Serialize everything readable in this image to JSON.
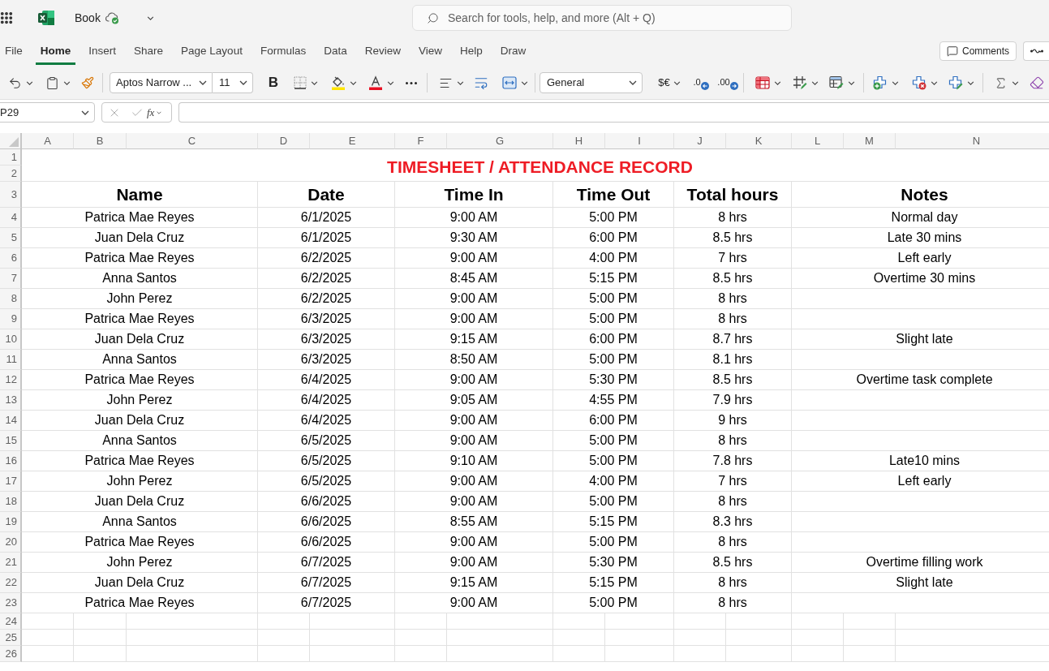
{
  "app_bar": {
    "document_title": "Book",
    "search": {
      "placeholder": "Search for tools, help, and more (Alt + Q)"
    }
  },
  "ribbon_tabs": [
    {
      "label": "File",
      "selected": false
    },
    {
      "label": "Home",
      "selected": true
    },
    {
      "label": "Insert",
      "selected": false
    },
    {
      "label": "Share",
      "selected": false
    },
    {
      "label": "Page Layout",
      "selected": false
    },
    {
      "label": "Formulas",
      "selected": false
    },
    {
      "label": "Data",
      "selected": false
    },
    {
      "label": "Review",
      "selected": false
    },
    {
      "label": "View",
      "selected": false
    },
    {
      "label": "Help",
      "selected": false
    },
    {
      "label": "Draw",
      "selected": false
    }
  ],
  "header_buttons": [
    {
      "label": "Comments"
    }
  ],
  "toolbar": {
    "font_name": "Aptos Narrow ...",
    "font_size": "11",
    "bold_label": "B",
    "number_format": "General",
    "currency_label": "$€",
    "decrease_decimal_label": ".0",
    "increase_decimal_label": ".00"
  },
  "formula_bar": {
    "name_box": "P29",
    "function_label": "fx"
  },
  "sheet": {
    "column_letters": [
      "A",
      "B",
      "C",
      "D",
      "E",
      "F",
      "G",
      "H",
      "I",
      "J",
      "K",
      "L",
      "M",
      "N"
    ],
    "row_numbers": [
      "1",
      "2",
      "3",
      "4",
      "5",
      "6",
      "7",
      "8",
      "9",
      "10",
      "11",
      "12",
      "13",
      "14",
      "15",
      "16",
      "17",
      "18",
      "19",
      "20",
      "21",
      "22",
      "23",
      "24",
      "25",
      "26"
    ],
    "title": "TIMESHEET / ATTENDANCE RECORD",
    "table": {
      "columns": [
        "Name",
        "Date",
        "Time In",
        "Time Out",
        "Total hours",
        "Notes"
      ],
      "rows": [
        {
          "name": "Patrica Mae Reyes",
          "date": "6/1/2025",
          "time_in": "9:00 AM",
          "time_out": "5:00 PM",
          "total_hours": "8 hrs",
          "notes": "Normal day"
        },
        {
          "name": "Juan Dela Cruz",
          "date": "6/1/2025",
          "time_in": "9:30 AM",
          "time_out": "6:00 PM",
          "total_hours": "8.5 hrs",
          "notes": "Late 30 mins"
        },
        {
          "name": "Patrica Mae Reyes",
          "date": "6/2/2025",
          "time_in": "9:00 AM",
          "time_out": "4:00 PM",
          "total_hours": "7 hrs",
          "notes": "Left early"
        },
        {
          "name": "Anna Santos",
          "date": "6/2/2025",
          "time_in": "8:45 AM",
          "time_out": "5:15 PM",
          "total_hours": "8.5 hrs",
          "notes": "Overtime 30 mins"
        },
        {
          "name": "John Perez",
          "date": "6/2/2025",
          "time_in": "9:00 AM",
          "time_out": "5:00 PM",
          "total_hours": "8 hrs"
        },
        {
          "name": "Patrica Mae Reyes",
          "date": "6/3/2025",
          "time_in": "9:00 AM",
          "time_out": "5:00 PM",
          "total_hours": "8 hrs"
        },
        {
          "name": "Juan Dela Cruz",
          "date": "6/3/2025",
          "time_in": "9:15 AM",
          "time_out": "6:00 PM",
          "total_hours": "8.7 hrs",
          "notes": "Slight late"
        },
        {
          "name": "Anna Santos",
          "date": "6/3/2025",
          "time_in": "8:50 AM",
          "time_out": "5:00 PM",
          "total_hours": "8.1 hrs"
        },
        {
          "name": "Patrica Mae Reyes",
          "date": "6/4/2025",
          "time_in": "9:00 AM",
          "time_out": "5:30 PM",
          "total_hours": "8.5 hrs",
          "notes": "Overtime task complete"
        },
        {
          "name": "John Perez",
          "date": "6/4/2025",
          "time_in": "9:05 AM",
          "time_out": "4:55 PM",
          "total_hours": "7.9 hrs"
        },
        {
          "name": "Juan Dela Cruz",
          "date": "6/4/2025",
          "time_in": "9:00 AM",
          "time_out": "6:00 PM",
          "total_hours": "9 hrs"
        },
        {
          "name": "Anna Santos",
          "date": "6/5/2025",
          "time_in": "9:00 AM",
          "time_out": "5:00 PM",
          "total_hours": "8 hrs"
        },
        {
          "name": "Patrica Mae Reyes",
          "date": "6/5/2025",
          "time_in": "9:10 AM",
          "time_out": "5:00 PM",
          "total_hours": "7.8 hrs",
          "notes": "Late10 mins"
        },
        {
          "name": "John Perez",
          "date": "6/5/2025",
          "time_in": "9:00 AM",
          "time_out": "4:00 PM",
          "total_hours": "7 hrs",
          "notes": "Left early"
        },
        {
          "name": "Juan Dela Cruz",
          "date": "6/6/2025",
          "time_in": "9:00 AM",
          "time_out": "5:00 PM",
          "total_hours": "8 hrs"
        },
        {
          "name": "Anna Santos",
          "date": "6/6/2025",
          "time_in": "8:55 AM",
          "time_out": "5:15 PM",
          "total_hours": "8.3 hrs"
        },
        {
          "name": "Patrica Mae Reyes",
          "date": "6/6/2025",
          "time_in": "9:00 AM",
          "time_out": "5:00 PM",
          "total_hours": "8 hrs"
        },
        {
          "name": "John Perez",
          "date": "6/7/2025",
          "time_in": "9:00 AM",
          "time_out": "5:30 PM",
          "total_hours": "8.5 hrs",
          "notes": "Overtime filling work"
        },
        {
          "name": "Juan Dela Cruz",
          "date": "6/7/2025",
          "time_in": "9:15 AM",
          "time_out": "5:15 PM",
          "total_hours": "8 hrs",
          "notes": "Slight late"
        },
        {
          "name": "Patrica Mae Reyes",
          "date": "6/7/2025",
          "time_in": "9:00 AM",
          "time_out": "5:00 PM",
          "total_hours": "8 hrs"
        }
      ]
    }
  }
}
